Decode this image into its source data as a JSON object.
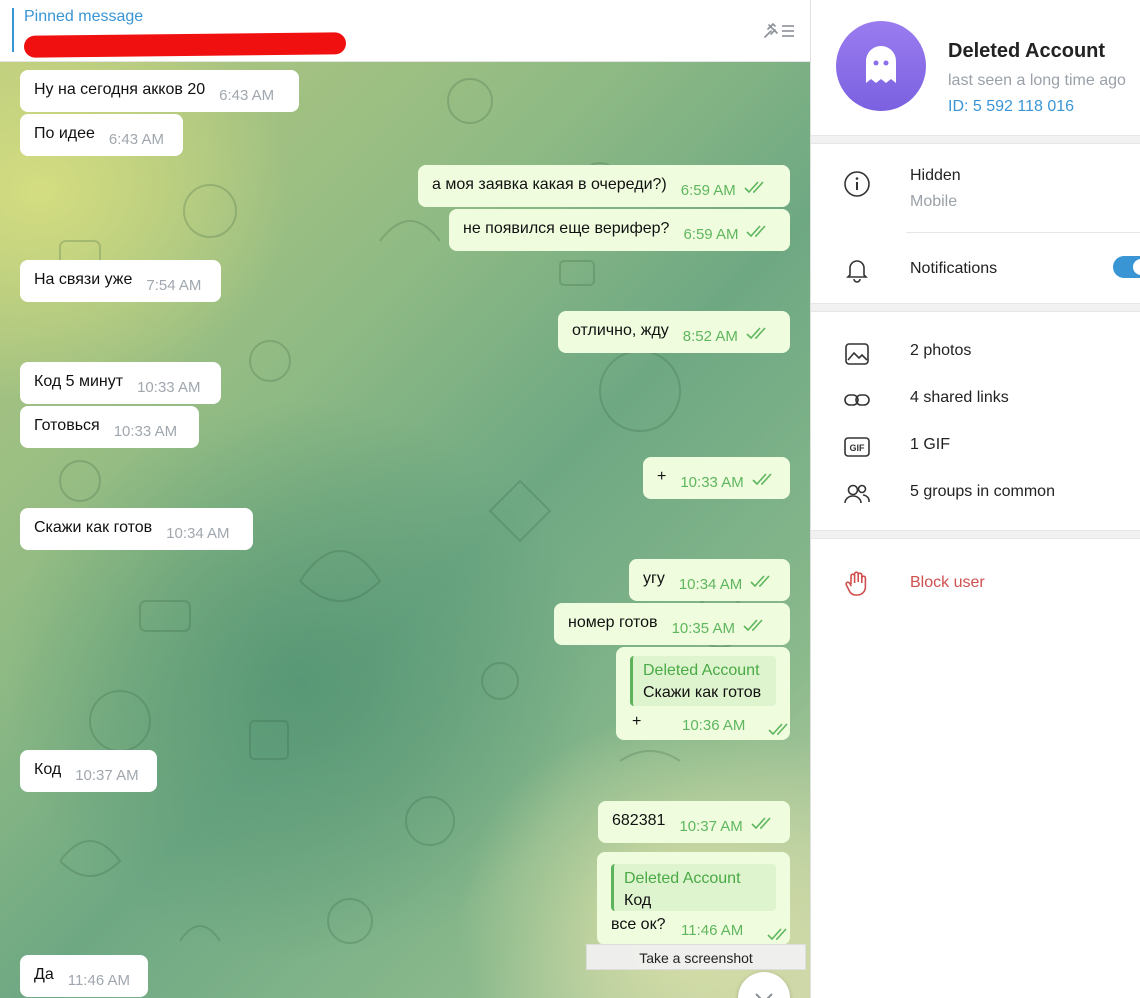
{
  "pinned": {
    "title": "Pinned message"
  },
  "messages": [
    {
      "dir": "in",
      "text": "Ну на сегодня акков 20",
      "time": "6:43 AM"
    },
    {
      "dir": "in",
      "text": "По идее",
      "time": "6:43 AM"
    },
    {
      "dir": "out",
      "text": "а моя заявка какая в очереди?)",
      "time": "6:59 AM"
    },
    {
      "dir": "out",
      "text": "не появился еще верифер?",
      "time": "6:59 AM"
    },
    {
      "dir": "in",
      "text": "На связи уже",
      "time": "7:54 AM"
    },
    {
      "dir": "out",
      "text": "отлично, жду",
      "time": "8:52 AM"
    },
    {
      "dir": "in",
      "text": "Код 5 минут",
      "time": "10:33 AM"
    },
    {
      "dir": "in",
      "text": "Готовься",
      "time": "10:33 AM"
    },
    {
      "dir": "out",
      "text": "+",
      "time": "10:33 AM"
    },
    {
      "dir": "in",
      "text": "Скажи как готов",
      "time": "10:34 AM"
    },
    {
      "dir": "out",
      "text": "угу",
      "time": "10:34 AM"
    },
    {
      "dir": "out",
      "text": "номер готов",
      "time": "10:35 AM"
    },
    {
      "dir": "out",
      "reply_to": {
        "name": "Deleted Account",
        "text": "Скажи как готов"
      },
      "text": "+",
      "time": "10:36 AM"
    },
    {
      "dir": "in",
      "text": "Код",
      "time": "10:37 AM"
    },
    {
      "dir": "out",
      "text": "682381",
      "time": "10:37 AM"
    },
    {
      "dir": "out",
      "reply_to": {
        "name": "Deleted Account",
        "text": "Код"
      },
      "text": "все ок?",
      "time": "11:46 AM"
    },
    {
      "dir": "in",
      "text": "Да",
      "time": "11:46 AM"
    }
  ],
  "tooltip": "Take a screenshot",
  "profile": {
    "name": "Deleted Account",
    "last_seen": "last seen a long time ago",
    "id": "ID: 5 592 118 016",
    "info": {
      "label": "Hidden",
      "sub": "Mobile"
    },
    "notifications": {
      "label": "Notifications",
      "enabled": true
    },
    "media": [
      {
        "icon": "photo-icon",
        "label": "2 photos"
      },
      {
        "icon": "link-icon",
        "label": "4 shared links"
      },
      {
        "icon": "gif-icon",
        "label": "1 GIF"
      },
      {
        "icon": "groups-icon",
        "label": "5 groups in common"
      }
    ],
    "block": "Block user"
  },
  "colors": {
    "accent": "#3a95d5",
    "outgoing_bubble": "#effdde",
    "incoming_bubble": "#ffffff",
    "danger": "#d14f4f",
    "check": "#5fb65e"
  }
}
